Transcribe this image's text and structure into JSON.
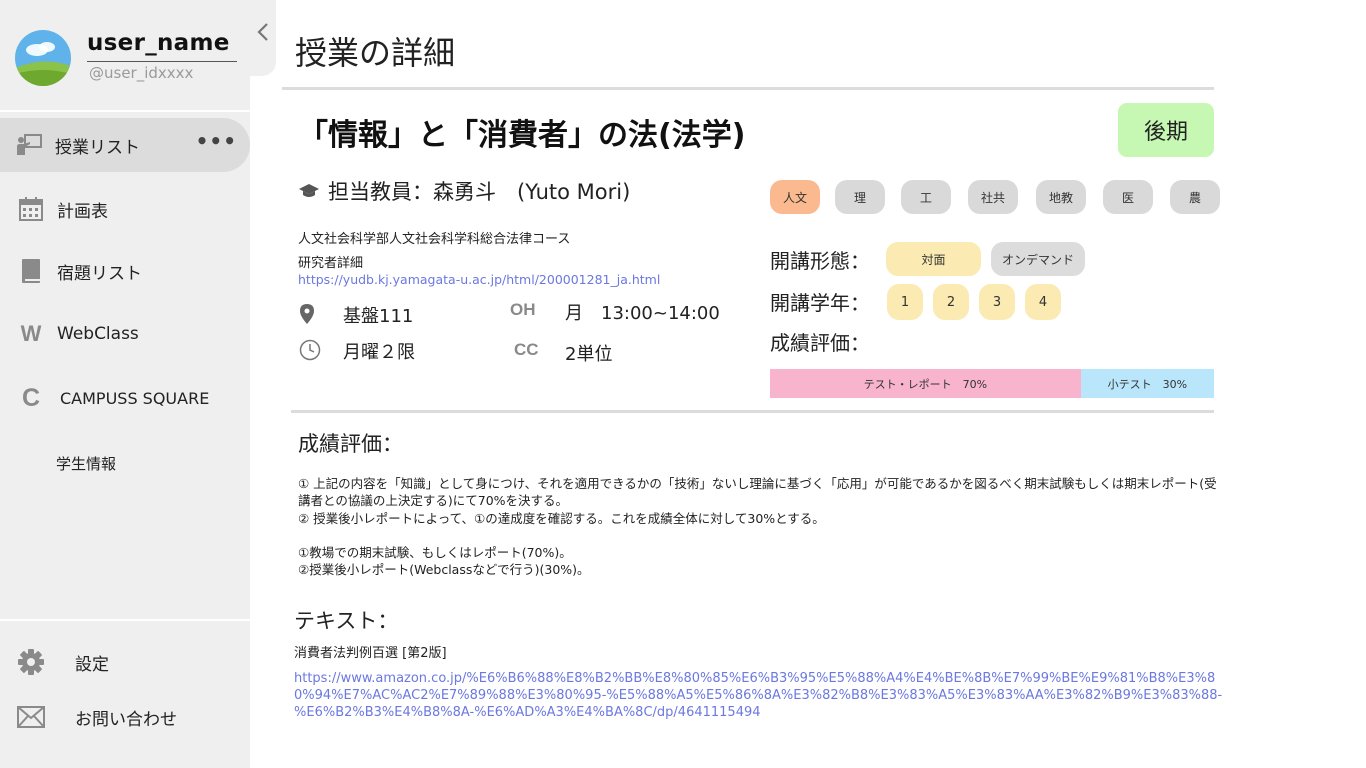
{
  "sidebar": {
    "user_name": "user_name",
    "user_id": "@user_idxxxx",
    "items": [
      {
        "label": "授業リスト",
        "icon": "teacher-board-icon"
      },
      {
        "label": "計画表",
        "icon": "calendar-icon"
      },
      {
        "label": "宿題リスト",
        "icon": "book-icon"
      },
      {
        "label": "WebClass",
        "icon": "letter-w-icon",
        "icon_glyph": "W"
      },
      {
        "label": "CAMPUSS SQUARE",
        "icon": "letter-c-icon",
        "icon_glyph": "C"
      },
      {
        "label": "学生情報"
      }
    ],
    "more_glyph": "•••",
    "bottom": [
      {
        "label": "設定",
        "icon": "gear-icon"
      },
      {
        "label": "お問い合わせ",
        "icon": "mail-icon"
      }
    ]
  },
  "main": {
    "page_title": "授業の詳細",
    "course_title": "「情報」と「消費者」の法(法学)",
    "term": "後期",
    "teacher": "担当教員：森勇斗　(Yuto Mori)",
    "department": "人文社会科学部人文社会科学科総合法律コース",
    "researcher_label": "研究者詳細",
    "researcher_link": "https://yudb.kj.yamagata-u.ac.jp/html/200001281_ja.html",
    "room": "基盤111",
    "period": "月曜２限",
    "oh_tag": "OH",
    "oh_value": "月　13:00~14:00",
    "cc_tag": "CC",
    "cc_value": "2単位",
    "fields": [
      "人文",
      "理",
      "工",
      "社共",
      "地教",
      "医",
      "農"
    ],
    "field_selected": "人文",
    "format_label": "開講形態：",
    "formats": [
      {
        "label": "対面",
        "selected": true
      },
      {
        "label": "オンデマンド",
        "selected": false
      }
    ],
    "year_label": "開講学年：",
    "years": [
      "1",
      "2",
      "3",
      "4"
    ],
    "grading_label": "成績評価：",
    "grading": [
      {
        "label": "テスト・レポート　70%",
        "share": 0.7,
        "color": "#f8b4cc"
      },
      {
        "label": "小テスト　30%",
        "share": 0.3,
        "color": "#b9e6fb"
      }
    ],
    "evaluation_title": "成績評価：",
    "evaluation_paragraphs": [
      "① 上記の内容を「知識」として身につけ、それを適用できるかの「技術」ないし理論に基づく「応用」が可能であるかを図るべく期末試験もしくは期末レポート(受講者との協議の上決定する)にて70%を決する。",
      "② 授業後小レポートによって、①の達成度を確認する。これを成績全体に対して30%とする。",
      "①教場での期末試験、もしくはレポート(70%)。",
      "②授業後小レポート(Webclassなどで行う)(30%)。"
    ],
    "text_title": "テキスト：",
    "book_title": "消費者法判例百選 [第2版]",
    "book_link": "https://www.amazon.co.jp/%E6%B6%88%E8%B2%BB%E8%80%85%E6%B3%95%E5%88%A4%E4%BE%8B%E7%99%BE%E9%81%B8%E3%80%94%E7%AC%AC2%E7%89%88%E3%80%95-%E5%88%A5%E5%86%8A%E3%82%B8%E3%83%A5%E3%83%AA%E3%82%B9%E3%83%88-%E6%B2%B3%E4%B8%8A-%E6%AD%A3%E4%BA%8C/dp/4641115494"
  },
  "colors": {
    "sidebar_bg": "#efefef",
    "active_item": "#dcdcdc",
    "term_badge": "#c6f7b3",
    "field_selected": "#fbb98f",
    "chip_yellow": "#fbeab2",
    "link": "#6b78e0"
  }
}
